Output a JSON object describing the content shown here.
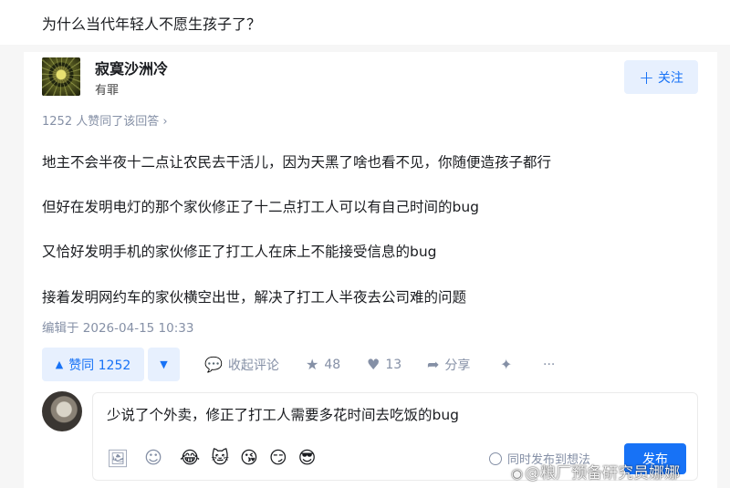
{
  "question": {
    "title": "为什么当代年轻人不愿生孩子了？"
  },
  "author": {
    "name": "寂寞沙洲冷",
    "bio": "有罪",
    "follow_label": "关注",
    "follow_icon": "plus-icon"
  },
  "answer": {
    "vote_summary": "1252 人赞同了该回答 ›",
    "paragraphs": [
      "地主不会半夜十二点让农民去干活儿，因为天黑了啥也看不见，你随便造孩子都行",
      "但好在发明电灯的那个家伙修正了十二点打工人可以有自己时间的bug",
      "又恰好发明手机的家伙修正了打工人在床上不能接受信息的bug",
      "接着发明网约车的家伙横空出世，解决了打工人半夜去公司难的问题"
    ],
    "edit_time": "编辑于 2026-04-15 10:33"
  },
  "actions": {
    "upvote_label": "赞同 1252",
    "comment_label": "收起评论",
    "star_count": "48",
    "like_count": "13",
    "share_label": "分享",
    "more_label": "···"
  },
  "comment": {
    "input_value": "少说了个外卖，修正了打工人需要多花时间去吃饭的bug",
    "sync_label": "同时发布到想法",
    "publish_label": "发布"
  },
  "watermark": {
    "text": "@粮厂预备研究员娜娜"
  },
  "colors": {
    "accent": "#1772f6",
    "accent_bg": "#e7f0fe",
    "muted": "#8590a6"
  }
}
